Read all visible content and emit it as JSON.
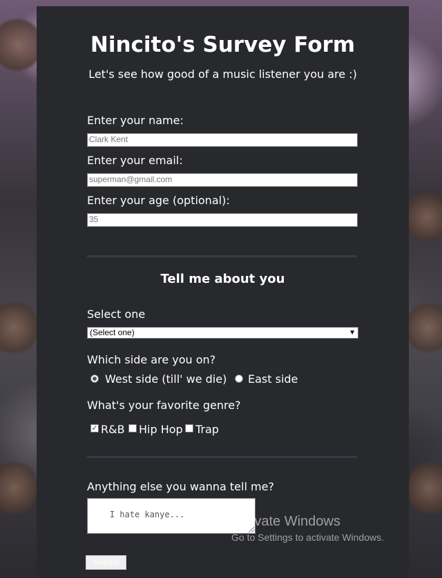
{
  "form": {
    "title": "Nincito's Survey Form",
    "subtitle": "Let's see how good of a music listener you are :)",
    "name_label": "Enter your name:",
    "name_placeholder": "Clark Kent",
    "email_label": "Enter your email:",
    "email_placeholder": "superman@gmail.com",
    "age_label": "Enter your age (optional):",
    "age_placeholder": "35",
    "section_title": "Tell me about you",
    "select_label": "Select one",
    "select_value": "(Select one)",
    "side_question": "Which side are you on?",
    "side_options": [
      {
        "label": "West side (till' we die)",
        "checked": true
      },
      {
        "label": "East side",
        "checked": false
      }
    ],
    "genre_question": "What's your favorite genre?",
    "genre_options": [
      {
        "label": "R&B",
        "checked": true
      },
      {
        "label": "Hip Hop",
        "checked": false
      },
      {
        "label": "Trap",
        "checked": false
      }
    ],
    "comments_label": "Anything else you wanna tell me?",
    "comments_placeholder": "I hate kanye...",
    "submit_label": "Submit"
  },
  "watermark": {
    "title": "Activate Windows",
    "subtitle": "Go to Settings to activate Windows."
  },
  "colors": {
    "card_bg": "#28292d",
    "divider": "#3a3a48",
    "text": "#ffffff"
  }
}
